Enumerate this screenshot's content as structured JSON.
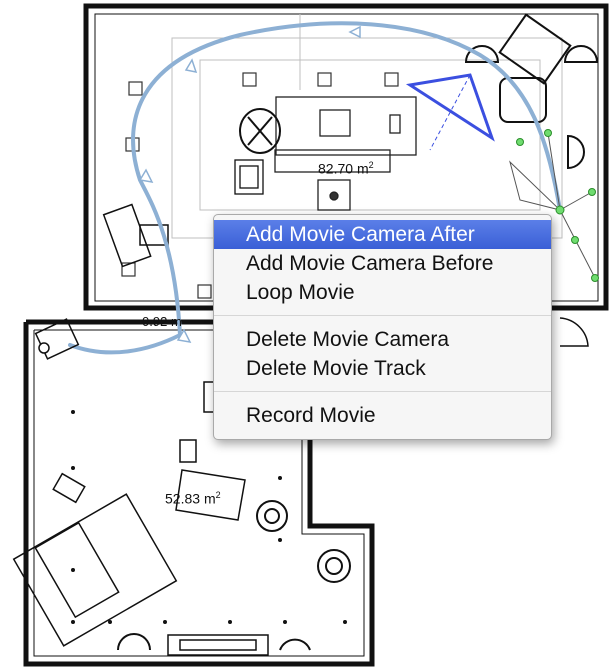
{
  "plan": {
    "room_upper_area": "82.70",
    "room_lower_area": "52.83",
    "area_unit": "m",
    "area_unit_exp": "2",
    "door_width": "0.92",
    "door_width_unit": "m"
  },
  "context_menu": {
    "items": [
      {
        "label": "Add Movie Camera After"
      },
      {
        "label": "Add Movie Camera Before"
      },
      {
        "label": "Loop Movie"
      },
      {
        "label": "Delete Movie Camera"
      },
      {
        "label": "Delete Movie Track"
      },
      {
        "label": "Record Movie"
      }
    ]
  },
  "colors": {
    "track": "#8db0d4",
    "camera_fov": "#3b4fe0",
    "selection_handle": "#6fdc6f",
    "menu_highlight": "#4a6fe0"
  }
}
